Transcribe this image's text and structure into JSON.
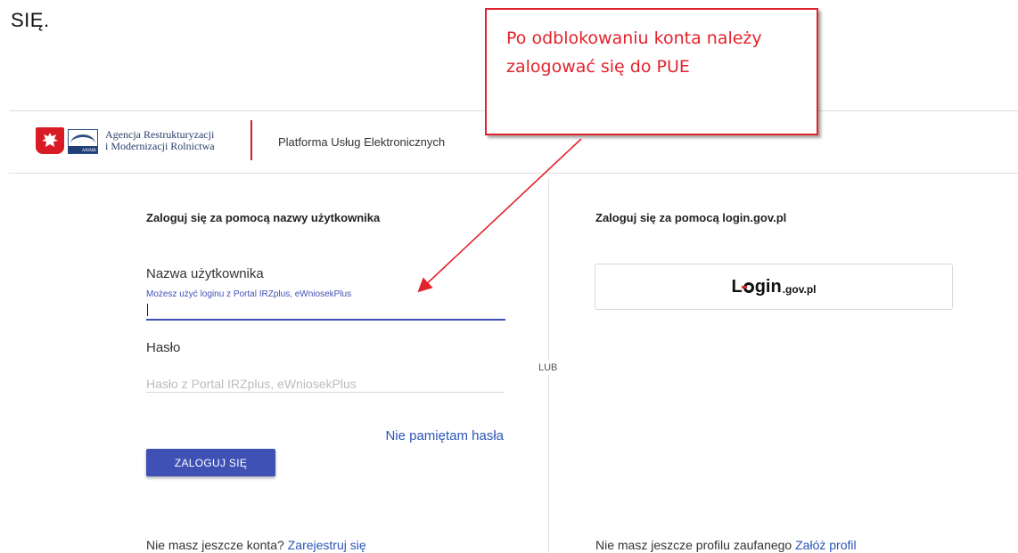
{
  "document": {
    "heading_fragment": "SIĘ."
  },
  "header": {
    "agency_line1": "Agencja Restrukturyzacji",
    "agency_line2": "i Modernizacji Rolnictwa",
    "logo_text": "ARiMR",
    "platform_name": "Platforma Usług Elektronicznych"
  },
  "login_form": {
    "heading": "Zaloguj się za pomocą nazwy użytkownika",
    "username_label": "Nazwa użytkownika",
    "username_hint": "Możesz użyć loginu z Portal IRZplus, eWniosekPlus",
    "username_value": "",
    "password_label": "Hasło",
    "password_placeholder": "Hasło z Portal IRZplus, eWniosekPlus",
    "forgot_password": "Nie pamiętam hasła",
    "submit_label": "ZALOGUJ SIĘ",
    "register_prompt": "Nie masz jeszcze konta?",
    "register_link": "Zarejestruj się"
  },
  "separator": {
    "label": "LUB"
  },
  "gov_login": {
    "heading": "Zaloguj się za pomocą login.gov.pl",
    "button_text_left": "L",
    "button_text_right": "gin",
    "button_suffix": ".gov.pl",
    "trusted_prompt": "Nie masz jeszcze profilu zaufanego",
    "trusted_link": "Załóż profil"
  },
  "annotation": {
    "text": "Po odblokowaniu konta należy zalogować się do PUE",
    "color": "#e3232c"
  },
  "colors": {
    "primary": "#3f51b5",
    "link": "#2a55b6",
    "brand_red": "#d81b24"
  }
}
